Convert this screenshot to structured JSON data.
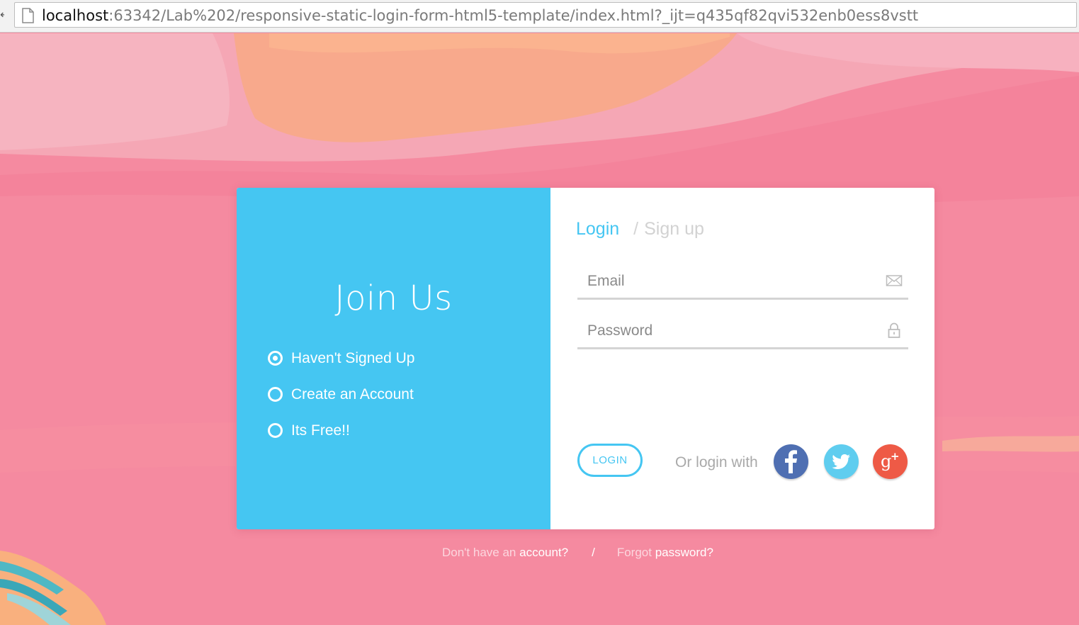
{
  "browser": {
    "url_host": "localhost",
    "url_rest": ":63342/Lab%202/responsive-static-login-form-html5-template/index.html?_ijt=q435qf82qvi532enb0ess8vstt"
  },
  "promo": {
    "title": "Join Us",
    "items": [
      {
        "label": "Haven't Signed Up",
        "checked": true
      },
      {
        "label": "Create an Account",
        "checked": false
      },
      {
        "label": "Its Free!!",
        "checked": false
      }
    ]
  },
  "form": {
    "tab_login": "Login",
    "tab_separator": "/",
    "tab_signup": "Sign up",
    "email_placeholder": "Email",
    "password_placeholder": "Password",
    "login_button": "LOGIN",
    "or_login_with": "Or login with"
  },
  "social": [
    {
      "name": "facebook",
      "icon": "facebook-icon",
      "color": "#4f6fb2"
    },
    {
      "name": "twitter",
      "icon": "twitter-icon",
      "color": "#5fcdef"
    },
    {
      "name": "google-plus",
      "icon": "google-plus-icon",
      "color": "#ee5a46"
    }
  ],
  "footer": {
    "no_account_prefix": "Don't have an",
    "no_account_link": "account?",
    "separator": "/",
    "forgot_prefix": "Forgot",
    "forgot_link": "password?"
  },
  "colors": {
    "accent": "#45c6f2",
    "background": "#f58aa0"
  }
}
